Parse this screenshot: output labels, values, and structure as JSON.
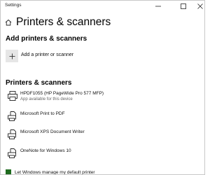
{
  "window": {
    "title": "Settings"
  },
  "header": {
    "title": "Printers & scanners"
  },
  "add_section": {
    "title": "Add printers & scanners",
    "add_label": "Add a printer or scanner"
  },
  "printers_section": {
    "title": "Printers & scanners",
    "items": [
      {
        "name": "HPDF1055 (HP PageWide Pro 577 MFP)",
        "sub": "App available for this device",
        "icon": "printer-icon"
      },
      {
        "name": "Microsoft Print to PDF",
        "sub": "",
        "icon": "document-printer-icon"
      },
      {
        "name": "Microsoft XPS Document Writer",
        "sub": "",
        "icon": "document-printer-icon"
      },
      {
        "name": "OneNote for Windows 10",
        "sub": "",
        "icon": "document-printer-icon"
      }
    ]
  },
  "default_printer": {
    "label": "Let Windows manage my default printer",
    "checked": true
  }
}
